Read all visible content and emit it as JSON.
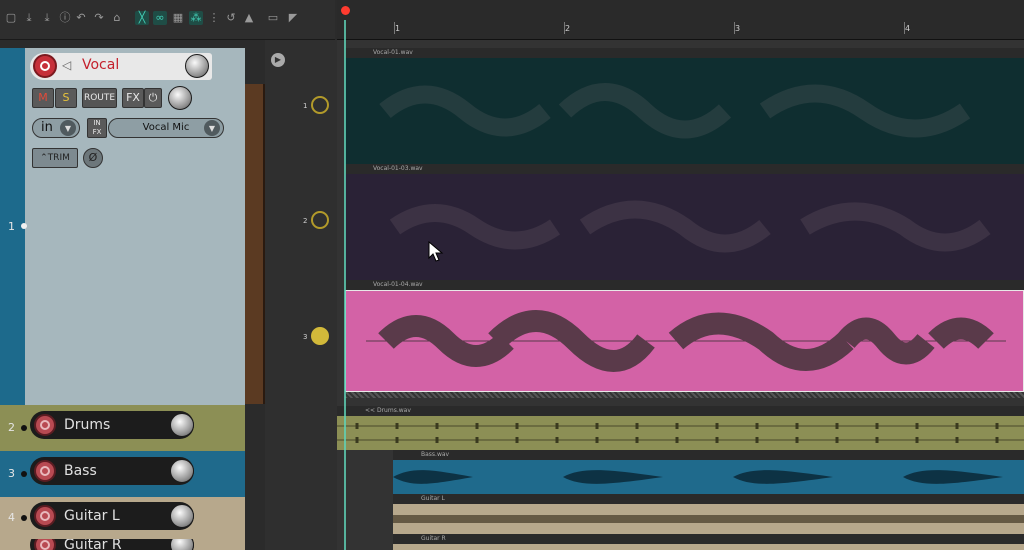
{
  "tracks": {
    "vocal": {
      "number": "1",
      "name": "Vocal",
      "buttons": {
        "mute": "M",
        "solo": "S",
        "route": "ROUTE",
        "fx": "FX",
        "trim": "TRIM",
        "in": "in",
        "infx": "IN FX"
      },
      "input": "Vocal Mic"
    },
    "drums": {
      "number": "2",
      "name": "Drums"
    },
    "bass": {
      "number": "3",
      "name": "Bass"
    },
    "guitar_l": {
      "number": "4",
      "name": "Guitar L"
    },
    "guitar_r": {
      "name": "Guitar R"
    }
  },
  "ruler": {
    "marks": [
      "1",
      "2",
      "3",
      "4"
    ]
  },
  "envelope": {
    "lanes": [
      "1",
      "2",
      "3"
    ]
  },
  "items": {
    "vocal_01": "Vocal-01.wav",
    "vocal_01_03": "Vocal-01-03.wav",
    "vocal_01_04": "Vocal-01-04.wav",
    "drums": "<< Drums.wav",
    "bass": "Bass.wav",
    "guitar_l": "Guitar L",
    "guitar_r": "Guitar R"
  },
  "colors": {
    "vocal_take_1": "#0f2e30",
    "vocal_take_2": "#2a2236",
    "vocal_take_3": "#d362a6",
    "drums": "#8c8f55",
    "bass": "#1f6a8c",
    "guitar": "#b7a88c"
  },
  "icons": [
    "new-file-icon",
    "save-icon",
    "download-icon",
    "info-icon",
    "undo-icon",
    "redo-icon",
    "metronome-icon",
    "grid-icon",
    "link-icon",
    "ripple-icon",
    "loop-icon",
    "lock-icon",
    "play-icon"
  ]
}
